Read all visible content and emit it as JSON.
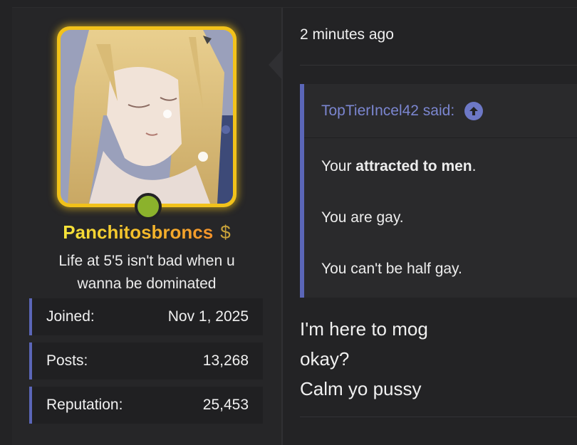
{
  "user": {
    "username": "Panchitosbroncs",
    "title_line1": "Life at 5'5 isn't bad when u",
    "title_line2": "wanna be dominated",
    "badge_icon": "dollar-sign-icon",
    "status_color": "#8bb22c",
    "stats": [
      {
        "label": "Joined:",
        "value": "Nov 1, 2025"
      },
      {
        "label": "Posts:",
        "value": "13,268"
      },
      {
        "label": "Reputation:",
        "value": "25,453"
      }
    ]
  },
  "post": {
    "timestamp": "2 minutes ago",
    "quote": {
      "author_label": "TopTierIncel42 said:",
      "line1_start": "Your ",
      "line1_bold": "attracted to men",
      "line1_end": ".",
      "line2": "You are gay.",
      "line3": "You can't be half gay."
    },
    "reply_lines": [
      "I'm here to mog",
      "okay?",
      "Calm yo pussy"
    ]
  },
  "colors": {
    "accent": "#5b66b8",
    "quote_author": "#7b86d0",
    "avatar_border": "#f2c21a"
  }
}
